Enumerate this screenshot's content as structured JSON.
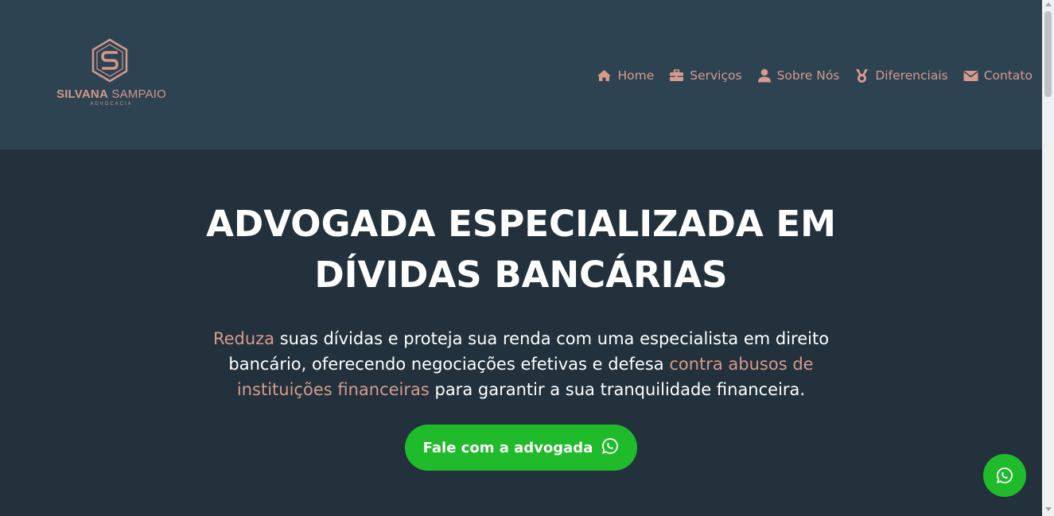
{
  "brand": {
    "name_bold": "SILVANA",
    "name_regular": " SAMPAIO",
    "subtitle": "ADVOCACIA",
    "color": "#d2988c"
  },
  "nav": {
    "items": [
      {
        "label": "Home",
        "icon": "home-icon"
      },
      {
        "label": "Serviços",
        "icon": "briefcase-icon"
      },
      {
        "label": "Sobre Nós",
        "icon": "user-icon"
      },
      {
        "label": "Diferenciais",
        "icon": "medal-icon"
      },
      {
        "label": "Contato",
        "icon": "envelope-icon"
      }
    ]
  },
  "hero": {
    "title_line1": "ADVOGADA ESPECIALIZADA EM",
    "title_line2": "DÍVIDAS BANCÁRIAS",
    "text_hl1": "Reduza",
    "text_part1": " suas dívidas e proteja sua renda com uma especialista em direito bancário, oferecendo negociações efetivas e defesa ",
    "text_hl2": "contra abusos de instituições financeiras",
    "text_part2": " para garantir a sua tranquilidade financeira.",
    "cta_label": "Fale com a advogada",
    "cta_icon": "whatsapp-icon"
  },
  "floating_button": {
    "icon": "whatsapp-icon"
  },
  "colors": {
    "header_bg": "#2d4352",
    "page_bg": "#22313b",
    "accent": "#d79a8c",
    "whatsapp_green": "#1fbb2a"
  }
}
